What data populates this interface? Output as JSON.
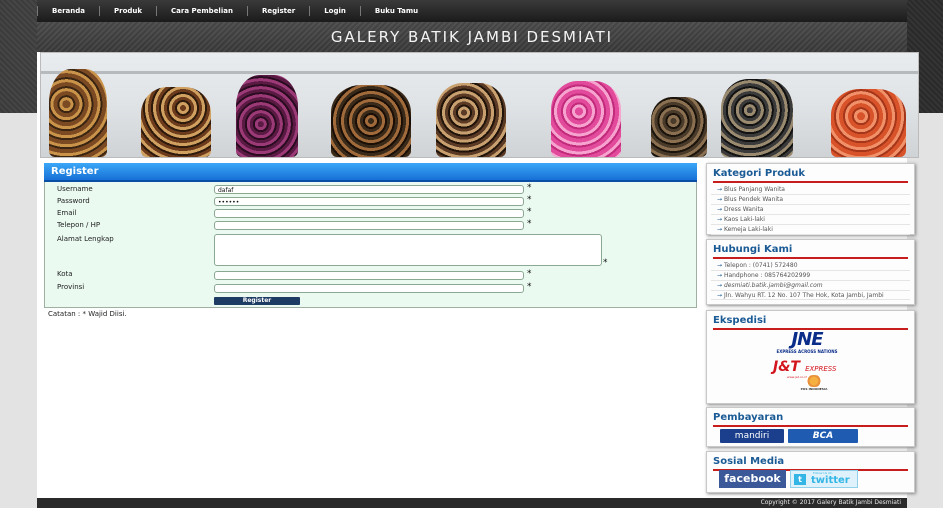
{
  "nav": [
    "Beranda",
    "Produk",
    "Cara Pembelian",
    "Register",
    "Login",
    "Buku Tamu"
  ],
  "site_title": "GALERY BATIK JAMBI DESMIATI",
  "register": {
    "title": "Register",
    "fields": [
      {
        "label": "Username",
        "value": "dafaf",
        "required": true
      },
      {
        "label": "Password",
        "value": "••••••",
        "required": true
      },
      {
        "label": "Email",
        "value": "",
        "required": true
      },
      {
        "label": "Telepon / HP",
        "value": "",
        "required": true
      },
      {
        "label": "Alamat Lengkap",
        "value": "",
        "required": true
      },
      {
        "label": "Kota",
        "value": "",
        "required": true
      },
      {
        "label": "Provinsi",
        "value": "",
        "required": true
      }
    ],
    "asterisk": "*",
    "button": "Register",
    "note": "Catatan : * Wajid Diisi."
  },
  "kategori": {
    "title": "Kategori Produk",
    "items": [
      "Blus Panjang Wanita",
      "Blus Pendek Wanita",
      "Dress Wanita",
      "Kaos Laki-laki",
      "Kemeja Laki-laki"
    ]
  },
  "hubungi": {
    "title": "Hubungi Kami",
    "items": [
      "Telepon : (0741) 572480",
      "Handphone : 085764202999",
      "desmiati.batik.jambi@gmail.com",
      "Jln. Wahyu RT. 12 No. 107 The Hok, Kota Jambi, Jambi"
    ]
  },
  "ekspedisi": {
    "title": "Ekspedisi",
    "jne": "JNE",
    "jne_tag": "EXPRESS ACROSS NATIONS",
    "jnt": "J&T",
    "jnt_tag": "EXPRESS",
    "jnt_url": "www.jet.co.id",
    "pos": "POS INDONESIA"
  },
  "pembayaran": {
    "title": "Pembayaran",
    "mandiri": "mandiri",
    "bca": "BCA"
  },
  "sosial": {
    "title": "Sosial Media",
    "facebook": "facebook",
    "twitter": "twitter",
    "twitter_tag": "Follow Us On"
  },
  "footer": "Copyright © 2017 Galery Batik Jambi Desmiati",
  "colors": {
    "accent": "#1670d6",
    "rule": "#c81d1d",
    "title": "#1a5a95"
  }
}
